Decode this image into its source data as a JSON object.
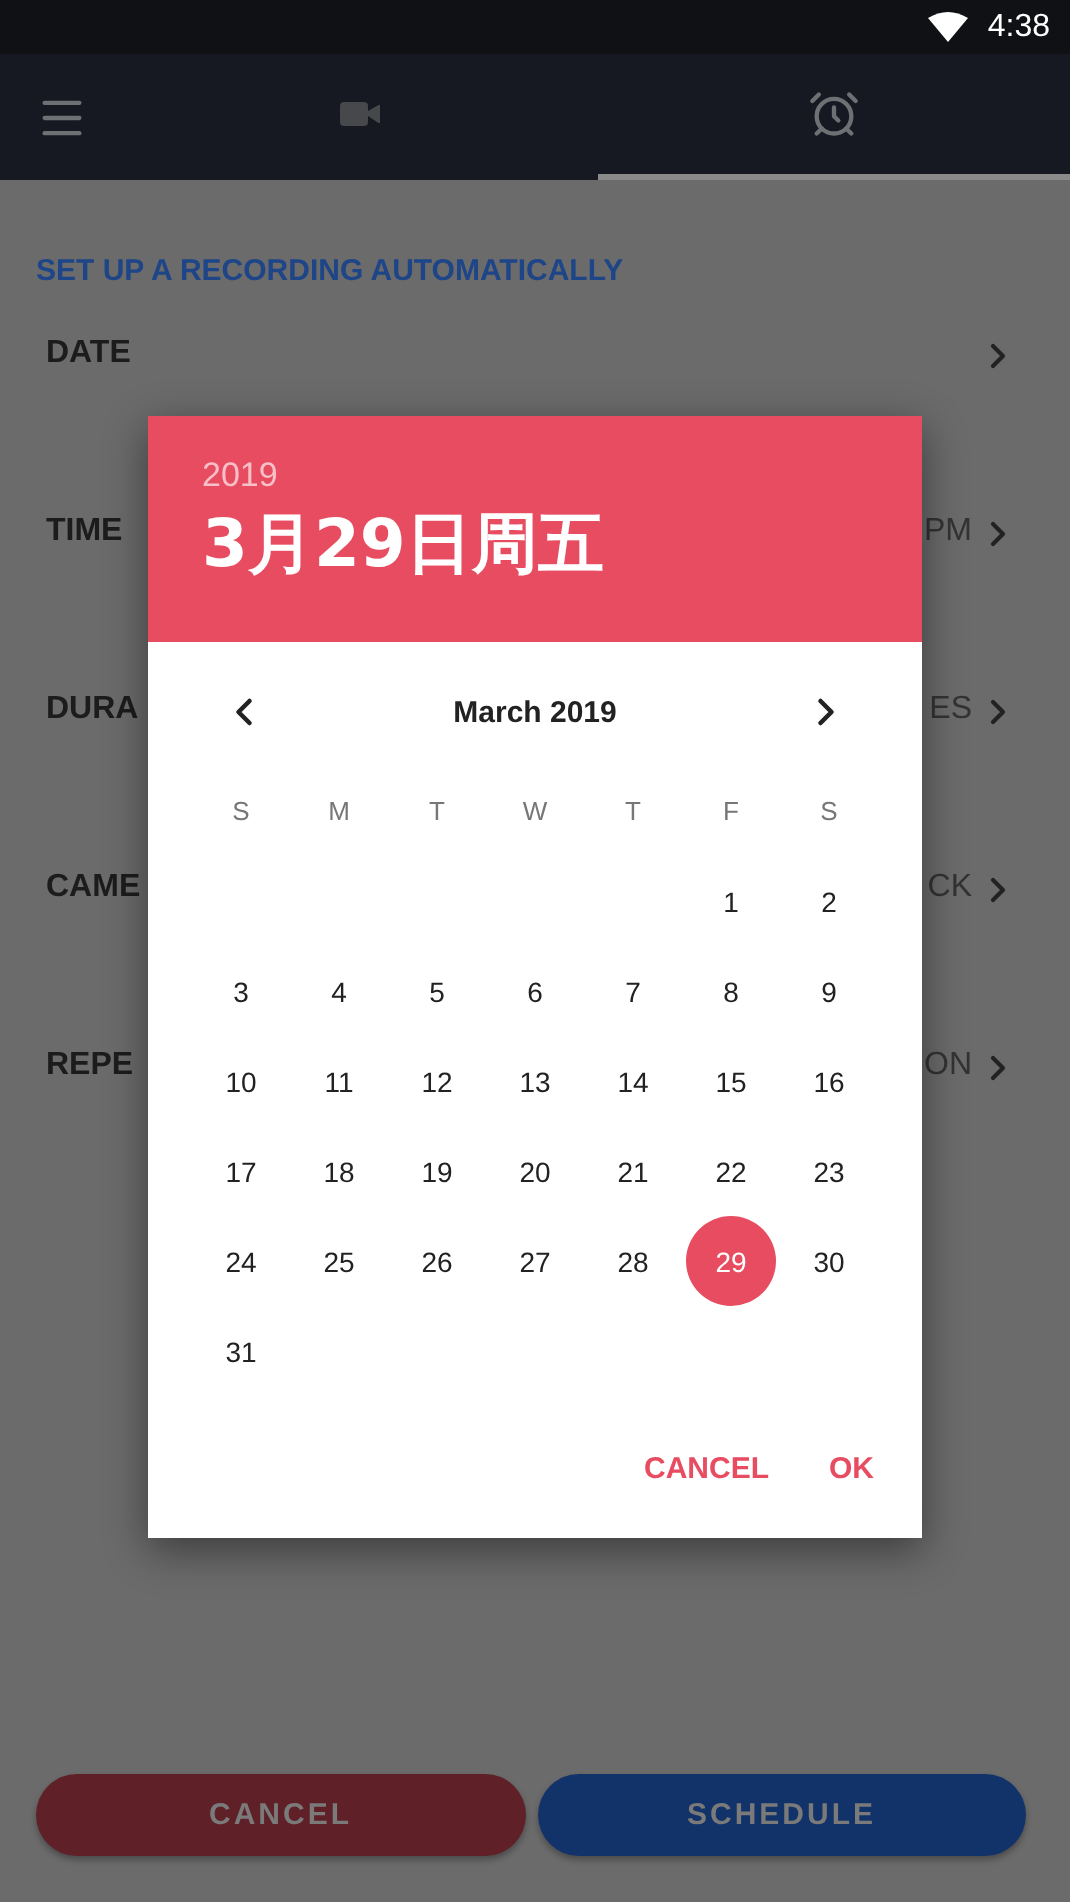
{
  "status_bar": {
    "time": "4:38"
  },
  "tabs": [
    {
      "kind": "video",
      "selected": false
    },
    {
      "kind": "alarm",
      "selected": true
    }
  ],
  "heading": "SET UP A RECORDING AUTOMATICALLY",
  "rows": [
    {
      "label": "DATE"
    },
    {
      "label": "TIME",
      "value": "PM"
    },
    {
      "label": "DURA",
      "value": "ES"
    },
    {
      "label": "CAME",
      "value": "CK"
    },
    {
      "label": "REPE",
      "value": "ON"
    }
  ],
  "footer_buttons": [
    {
      "kind": "cancel",
      "label": "CANCEL"
    },
    {
      "kind": "schedule",
      "label": "SCHEDULE"
    }
  ],
  "date_picker": {
    "year": "2019",
    "date": "3月29日周五",
    "month": "March 2019",
    "weekdays": [
      "S",
      "M",
      "T",
      "W",
      "T",
      "F",
      "S"
    ],
    "weeks": [
      [
        {
          "day": "1",
          "selected": false
        },
        {
          "day": "2",
          "selected": false
        }
      ],
      [
        {
          "day": "3",
          "selected": false
        },
        {
          "day": "4",
          "selected": false
        },
        {
          "day": "5",
          "selected": false
        },
        {
          "day": "6",
          "selected": false
        },
        {
          "day": "7",
          "selected": false
        },
        {
          "day": "8",
          "selected": false
        },
        {
          "day": "9",
          "selected": false
        }
      ],
      [
        {
          "day": "10",
          "selected": false
        },
        {
          "day": "11",
          "selected": false
        },
        {
          "day": "12",
          "selected": false
        },
        {
          "day": "13",
          "selected": false
        },
        {
          "day": "14",
          "selected": false
        },
        {
          "day": "15",
          "selected": false
        },
        {
          "day": "16",
          "selected": false
        }
      ],
      [
        {
          "day": "17",
          "selected": false
        },
        {
          "day": "18",
          "selected": false
        },
        {
          "day": "19",
          "selected": false
        },
        {
          "day": "20",
          "selected": false
        },
        {
          "day": "21",
          "selected": false
        },
        {
          "day": "22",
          "selected": false
        },
        {
          "day": "23",
          "selected": false
        }
      ],
      [
        {
          "day": "24",
          "selected": false
        },
        {
          "day": "25",
          "selected": false
        },
        {
          "day": "26",
          "selected": false
        },
        {
          "day": "27",
          "selected": false
        },
        {
          "day": "28",
          "selected": false
        },
        {
          "day": "29",
          "selected": true
        },
        {
          "day": "30",
          "selected": false
        }
      ],
      [
        {
          "day": "31",
          "selected": false
        }
      ]
    ],
    "buttons": [
      "CANCEL",
      "OK"
    ]
  }
}
